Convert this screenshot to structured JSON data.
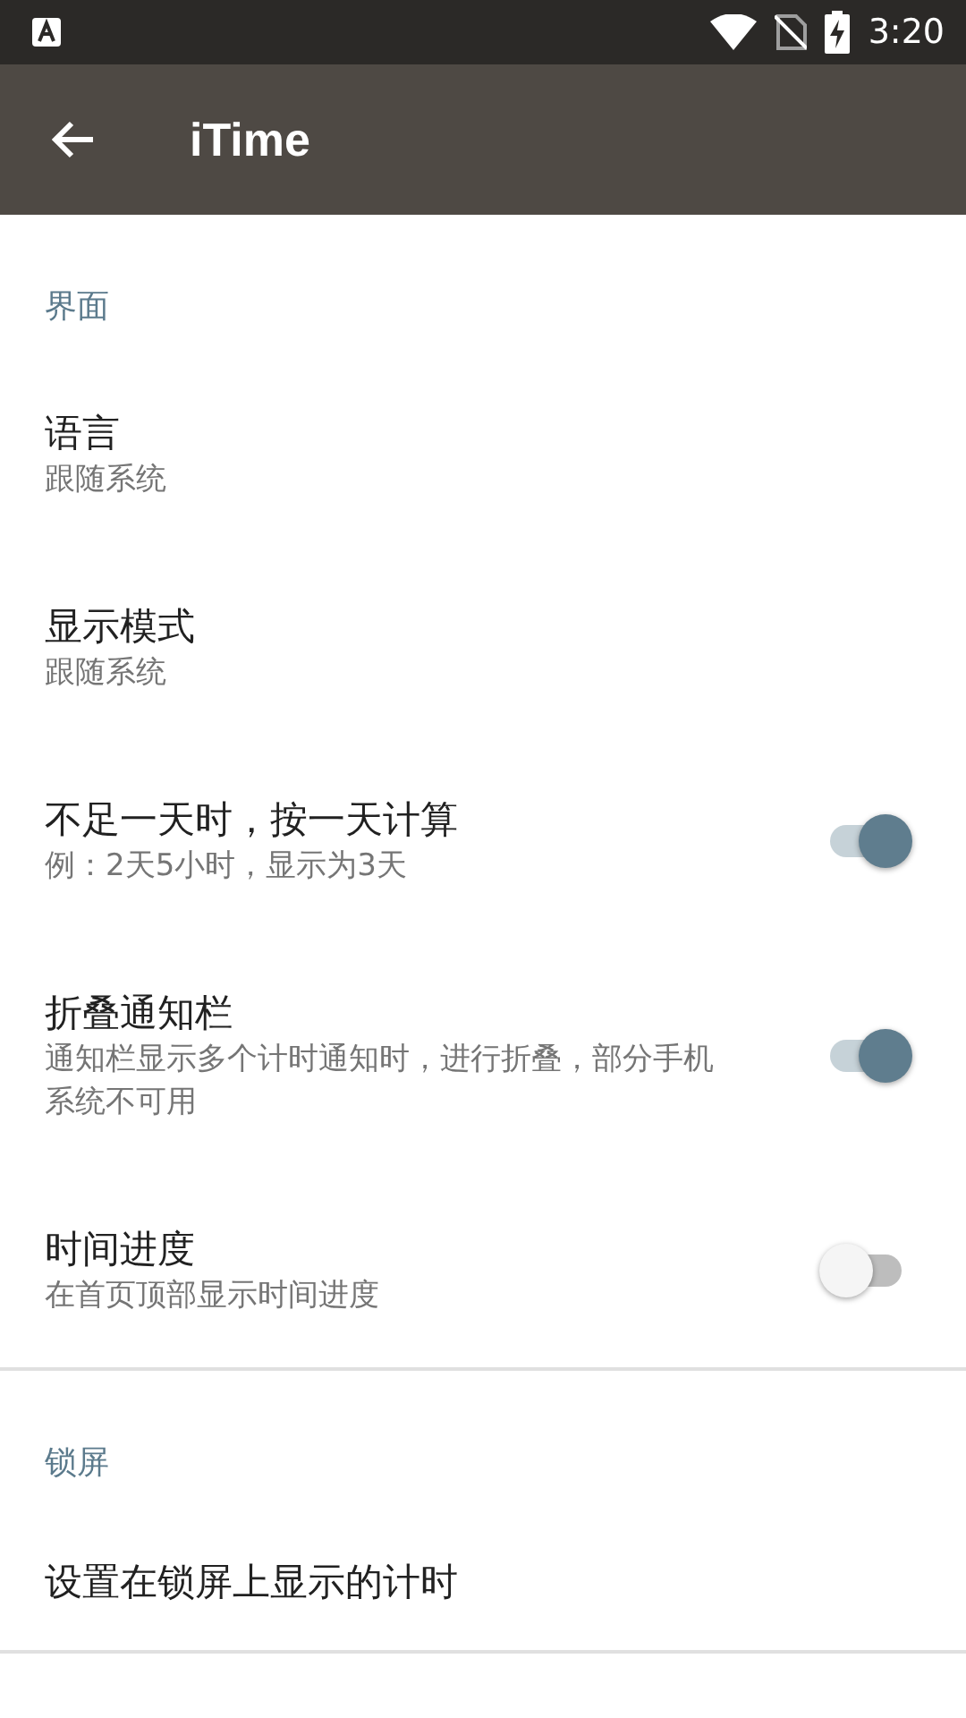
{
  "status_bar": {
    "time": "3:20"
  },
  "app_bar": {
    "title": "iTime"
  },
  "sections": [
    {
      "title": "界面",
      "items": [
        {
          "kind": "plain",
          "title": "语言",
          "subtitle": "跟随系统"
        },
        {
          "kind": "plain",
          "title": "显示模式",
          "subtitle": "跟随系统"
        },
        {
          "kind": "switch",
          "title": "不足一天时，按一天计算",
          "subtitle": "例：2天5小时，显示为3天",
          "on": true
        },
        {
          "kind": "switch",
          "title": "折叠通知栏",
          "subtitle": "通知栏显示多个计时通知时，进行折叠，部分手机系统不可用",
          "on": true
        },
        {
          "kind": "switch",
          "title": "时间进度",
          "subtitle": "在首页顶部显示时间进度",
          "on": false
        }
      ]
    },
    {
      "title": "锁屏",
      "items": [
        {
          "kind": "plain",
          "title": "设置在锁屏上显示的计时"
        }
      ]
    }
  ]
}
